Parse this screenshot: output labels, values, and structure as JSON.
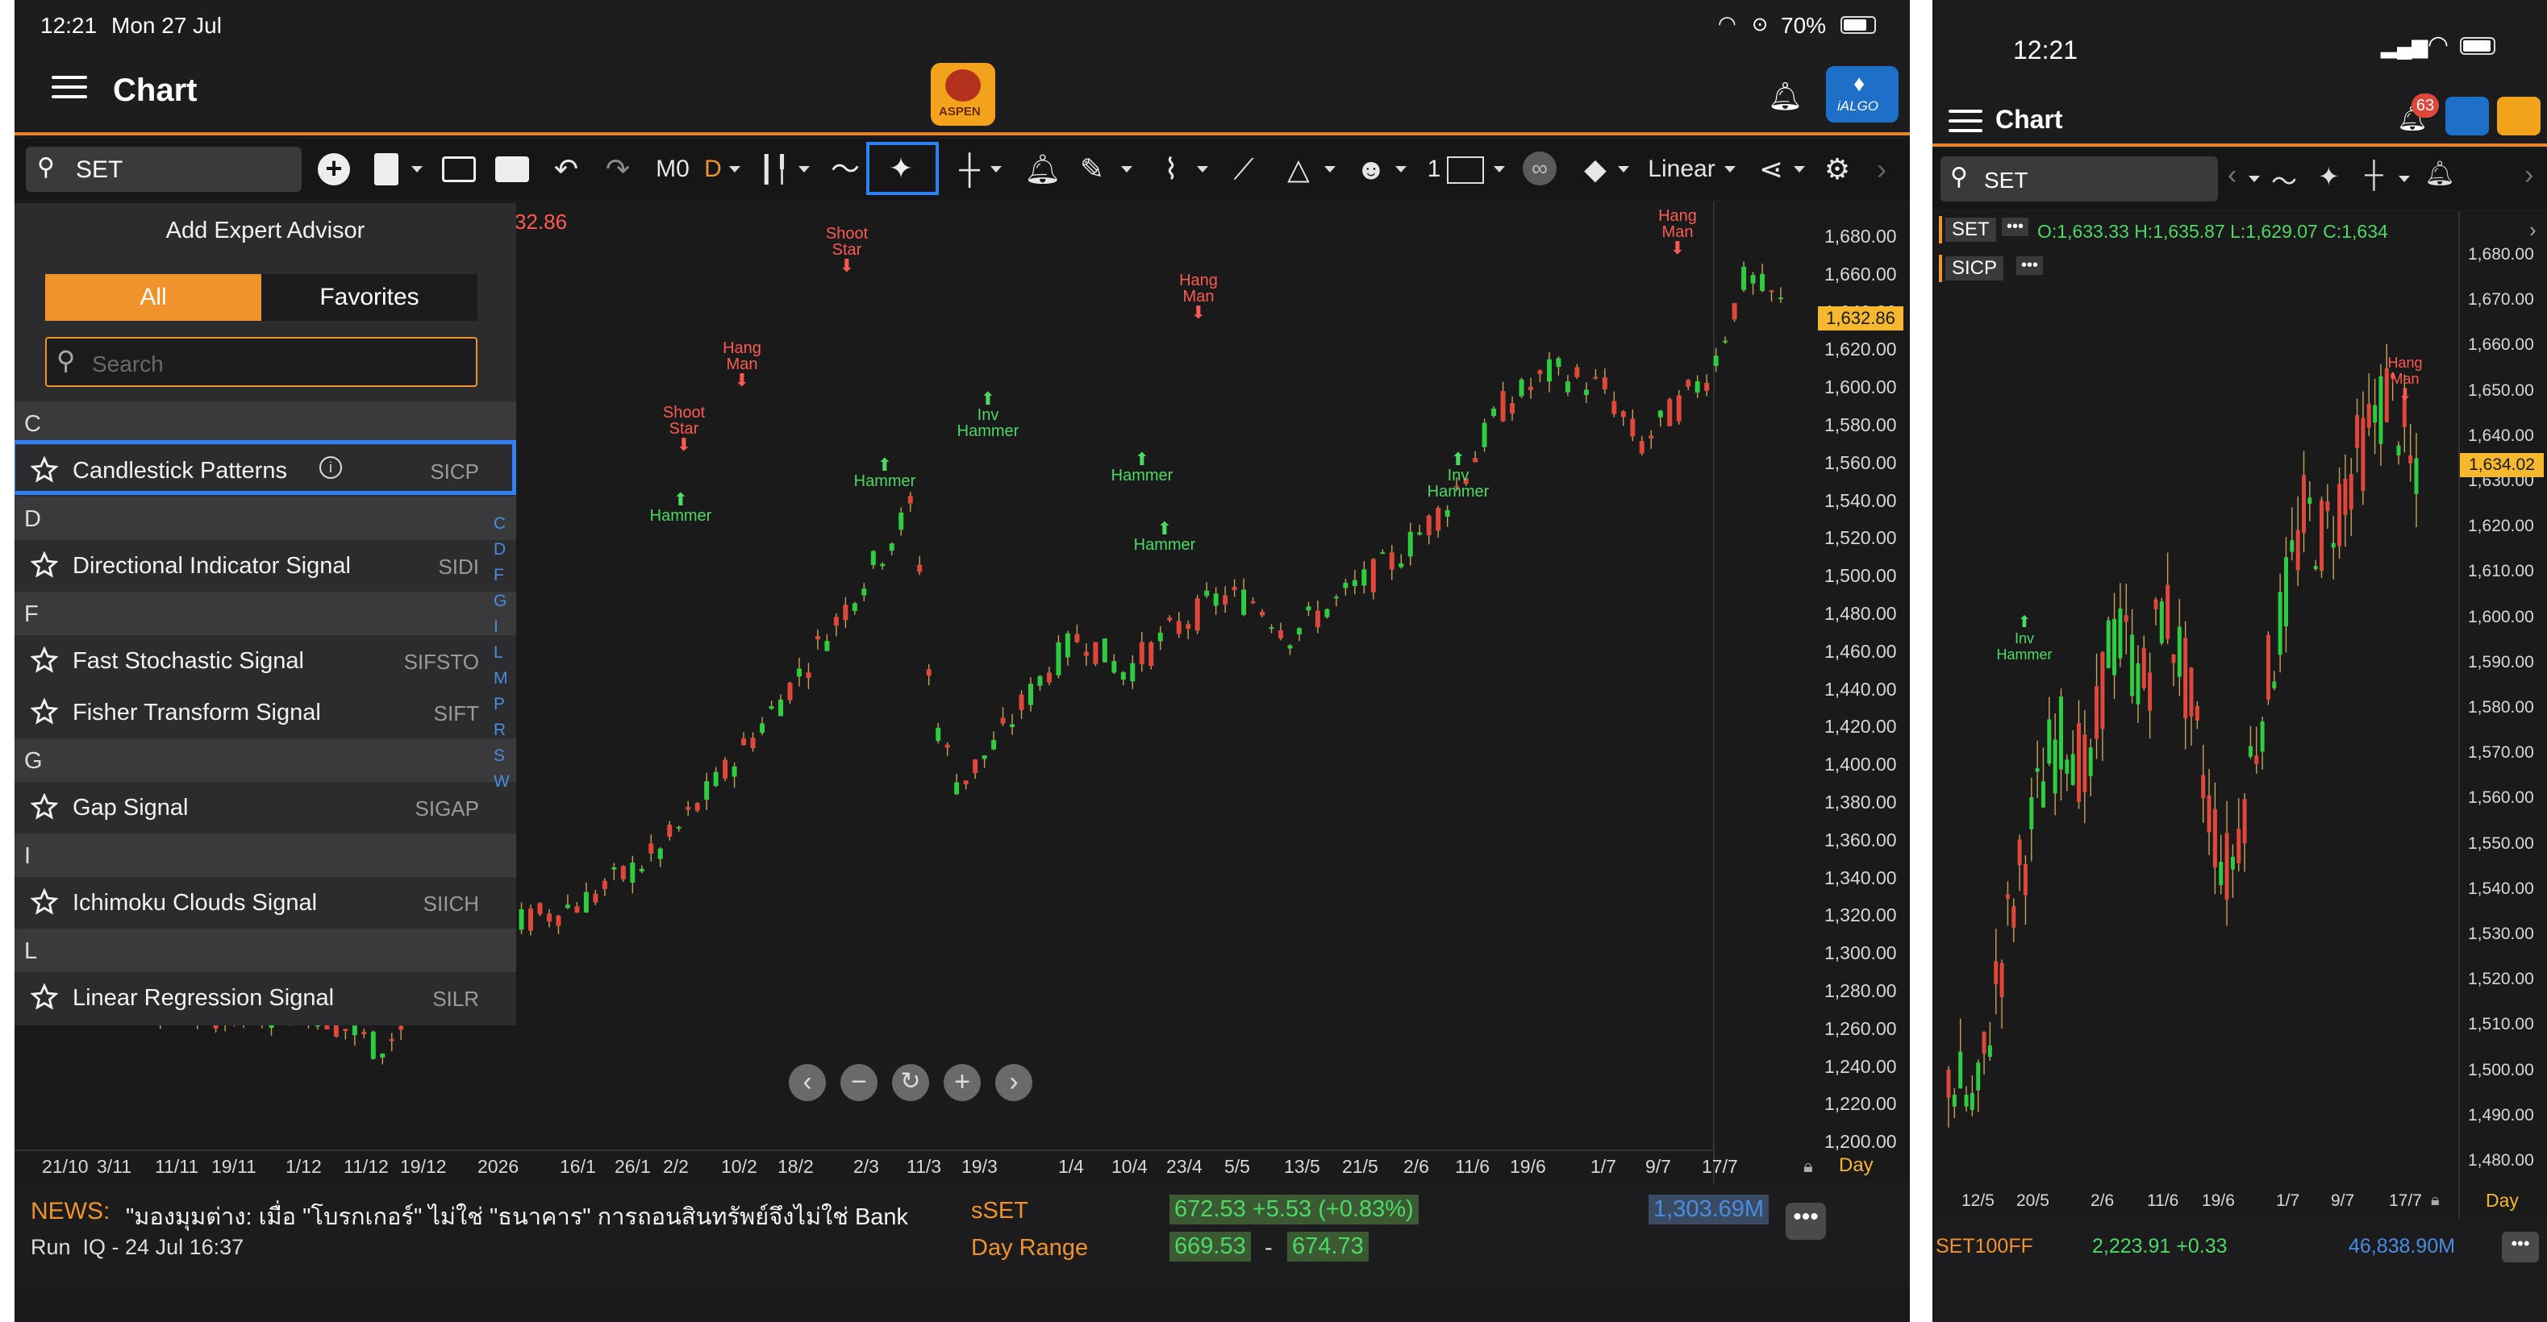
{
  "tablet": {
    "status": {
      "time": "12:21",
      "date": "Mon 27 Jul",
      "battery": "70%"
    },
    "header": {
      "title": "Chart",
      "logo_text": "ASPEN",
      "algo_text": "iALGO"
    },
    "toolbar": {
      "symbol": "SET",
      "period": "M0",
      "interval": "D",
      "brush_size": "1",
      "scale": "Linear"
    },
    "panel": {
      "title": "Add Expert Advisor",
      "tab_all": "All",
      "tab_favorites": "Favorites",
      "search_placeholder": "Search",
      "sections": [
        {
          "letter": "C",
          "items": [
            {
              "name": "Candlestick Patterns",
              "code": "SICP"
            }
          ]
        },
        {
          "letter": "D",
          "items": [
            {
              "name": "Directional Indicator Signal",
              "code": "SIDI"
            }
          ]
        },
        {
          "letter": "F",
          "items": [
            {
              "name": "Fast Stochastic Signal",
              "code": "SIFSTO"
            },
            {
              "name": "Fisher Transform Signal",
              "code": "SIFT"
            }
          ]
        },
        {
          "letter": "G",
          "items": [
            {
              "name": "Gap Signal",
              "code": "SIGAP"
            }
          ]
        },
        {
          "letter": "I",
          "items": [
            {
              "name": "Ichimoku Clouds Signal",
              "code": "SIICH"
            }
          ]
        },
        {
          "letter": "L",
          "items": [
            {
              "name": "Linear Regression Signal",
              "code": "SILR"
            }
          ]
        }
      ],
      "az_index": [
        "C",
        "D",
        "F",
        "G",
        "I",
        "L",
        "M",
        "P",
        "R",
        "S",
        "W"
      ]
    },
    "chart": {
      "partial_label": "32.86",
      "current_price": "1,632.86",
      "y_ticks": [
        "1,680.00",
        "1,660.00",
        "1,640.00",
        "1,620.00",
        "1,600.00",
        "1,580.00",
        "1,560.00",
        "1,540.00",
        "1,520.00",
        "1,500.00",
        "1,480.00",
        "1,460.00",
        "1,440.00",
        "1,420.00",
        "1,400.00",
        "1,380.00",
        "1,360.00",
        "1,340.00",
        "1,320.00",
        "1,300.00",
        "1,280.00",
        "1,260.00",
        "1,240.00",
        "1,220.00",
        "1,200.00"
      ],
      "x_ticks": [
        "21/10",
        "3/11",
        "11/11",
        "19/11",
        "1/12",
        "11/12",
        "19/12",
        "2026",
        "16/1",
        "26/1",
        "2/2",
        "10/2",
        "18/2",
        "2/3",
        "11/3",
        "19/3",
        "1/4",
        "10/4",
        "23/4",
        "5/5",
        "13/5",
        "21/5",
        "2/6",
        "11/6",
        "19/6",
        "1/7",
        "9/7",
        "17/7"
      ],
      "x_unit": "Day",
      "patterns": [
        {
          "text": "Hang Man",
          "color": "red"
        },
        {
          "text": "Shoot Star",
          "color": "red"
        },
        {
          "text": "Hang Man",
          "color": "red"
        },
        {
          "text": "Shoot Star",
          "color": "red"
        },
        {
          "text": "Hang Man",
          "color": "red"
        },
        {
          "text": "Hammer",
          "color": "green"
        },
        {
          "text": "Hammer",
          "color": "green"
        },
        {
          "text": "Inv Hammer",
          "color": "green"
        },
        {
          "text": "Hammer",
          "color": "green"
        },
        {
          "text": "Hammer",
          "color": "green"
        },
        {
          "text": "Inv Hammer",
          "color": "green"
        }
      ]
    },
    "footer": {
      "news_label": "NEWS:",
      "news_text": "\"มองมุมต่าง: เมื่อ \"โบรกเกอร์\" ไม่ใช่ \"ธนาคาร\" การถอนสินทรัพย์จึงไม่ใช่ Bank",
      "news_meta": "Run  IQ - 24 Jul 16:37",
      "quote_symbol": "sSET",
      "quote_value": "672.53 +5.53 (+0.83%)",
      "volume": "1,303.69M",
      "day_range_label": "Day Range",
      "day_low": "669.53",
      "dash": "-",
      "day_high": "674.73"
    }
  },
  "phone": {
    "status": {
      "time": "12:21"
    },
    "header": {
      "title": "Chart",
      "badge": "63"
    },
    "symbol": "SET",
    "ohlc": "O:1,633.33 H:1,635.87 L:1,629.07 C:1,634",
    "indicator": "SICP",
    "current_price": "1,634.02",
    "y_ticks": [
      "1,680.00",
      "1,670.00",
      "1,660.00",
      "1,650.00",
      "1,640.00",
      "1,630.00",
      "1,620.00",
      "1,610.00",
      "1,600.00",
      "1,590.00",
      "1,580.00",
      "1,570.00",
      "1,560.00",
      "1,550.00",
      "1,540.00",
      "1,530.00",
      "1,520.00",
      "1,510.00",
      "1,500.00",
      "1,490.00",
      "1,480.00"
    ],
    "x_ticks": [
      "12/5",
      "20/5",
      "2/6",
      "11/6",
      "19/6",
      "1/7",
      "9/7",
      "17/7"
    ],
    "x_unit": "Day",
    "patterns": [
      {
        "text": "Hang Man",
        "color": "red"
      },
      {
        "text": "Inv Hammer",
        "color": "green"
      }
    ],
    "footer": {
      "symbol": "SET100FF",
      "value": "2,223.91 +0.33",
      "volume": "46,838.90M"
    }
  },
  "colors": {
    "accent": "#f0932b",
    "highlight": "#2f7ff5",
    "up": "#2ecc40",
    "down": "#e0473b"
  }
}
